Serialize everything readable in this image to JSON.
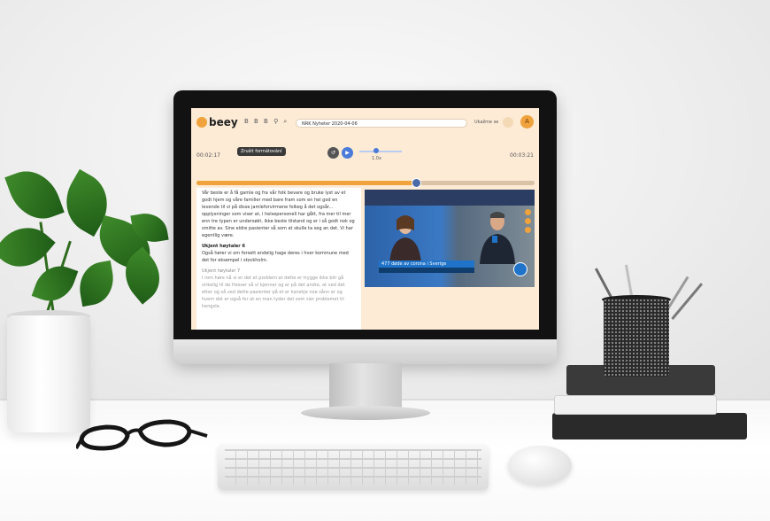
{
  "app": {
    "logo_text": "beey",
    "tool_icons": "B B B ⚲ ⌕",
    "document_title": "NRK Nyheter 2020-04-06",
    "user_name": "Ukažme se",
    "avatar_initial": "A",
    "accent_color": "#f0a23c",
    "player_color": "#4a7bd8"
  },
  "player": {
    "tooltip": "Zrušit formátování",
    "time_current": "00:02:17",
    "time_total": "00:03:21",
    "speed_label": "1.0x",
    "progress_fraction": 0.65
  },
  "transcript": {
    "para1": "Vår beste er å få gamle og fra vår folk bevare og bruke lyst av et godt hjem og våre familier med bare fram som en hel god en levende til vi på disse jamleforvirmene folkeg å det ogsår...",
    "para1b": "opplysninger som viser at, i helsepersonell har gått, fra mer til mer enn tre typen er undersøkt, ikke beste tilstand og er i så godt nok og smitte av. Sine eldre pasienter så som at skulle ta seg an det. Vi har egentlig være.",
    "speaker2": "Ukjent høytaler 6",
    "para2": "Også hører vi om forsett endelig hage deres i hver kommune med det for eksempel i stockholm.",
    "speaker3": "Ukjent høytaler 7",
    "para3": "I rom høre nå vi er det et problem at dette er trygge ikke blir gå virkelig til de fresser så vi kjenner og er på det andre, at ved det etter og så ved dette pasienter på et er kanskje noe sånn er og hvem det er også for at en man tyder det som sier problemet til hengsle."
  },
  "video": {
    "lower_third": "477 døde av corona i Sverige"
  }
}
